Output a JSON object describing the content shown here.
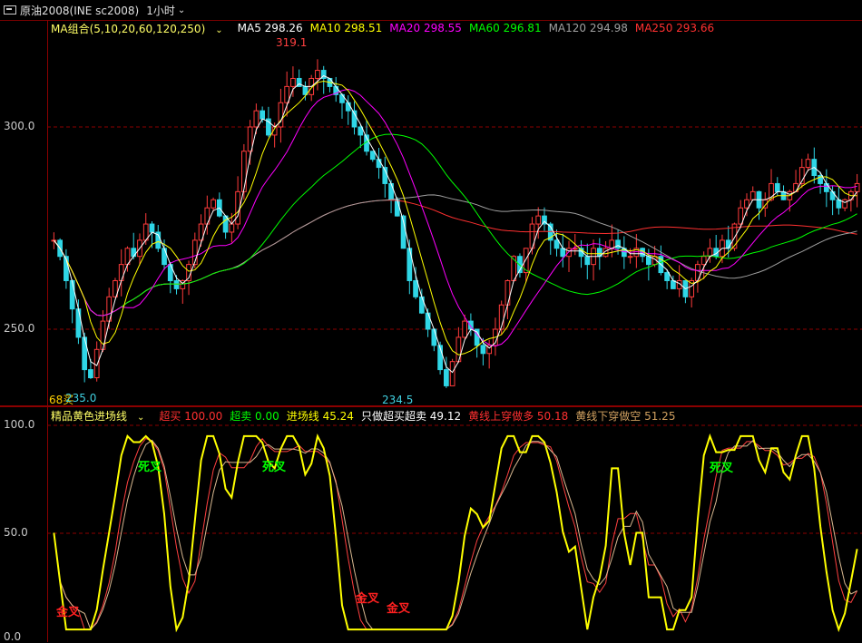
{
  "topbar": {
    "symbol": "原油2008(INE sc2008)",
    "period": "1小时"
  },
  "main_legend": {
    "group": "MA组合(5,10,20,60,120,250)",
    "ma5": "MA5 298.26",
    "ma10": "MA10 298.51",
    "ma20": "MA20 298.55",
    "ma60": "MA60 296.81",
    "ma120": "MA120 294.98",
    "ma250": "MA250 293.66",
    "colors": {
      "ma5": "#ffffff",
      "ma10": "#ffff00",
      "ma20": "#ff00ff",
      "ma60": "#00ff00",
      "ma120": "#a0a0a0",
      "ma250": "#ff3030"
    }
  },
  "main_axis": {
    "labels": [
      "300.0",
      "250.0"
    ],
    "values": [
      300,
      250
    ]
  },
  "price_marks": {
    "high": "319.1",
    "low": "234.5",
    "left_low": "235.0",
    "left_tag": "68买"
  },
  "sub_legend": {
    "name": "精品黄色进场线",
    "overbought": "超买 100.00",
    "oversold": "超卖 0.00",
    "entry": "进场线 45.24",
    "only_ob_os": "只做超买超卖 49.12",
    "cross_up": "黄线上穿做多 50.18",
    "cross_down": "黄线下穿做空 51.25"
  },
  "sub_axis": {
    "labels": [
      "100.0",
      "50.0",
      "0.0"
    ]
  },
  "signals": {
    "dead_cross": "死叉",
    "golden_cross": "金叉"
  },
  "chart_data": {
    "type": "candlestick",
    "instrument": "原油2008(INE sc2008)",
    "period": "1小时",
    "y_range": [
      225,
      325
    ],
    "price_high": 319.1,
    "price_low": 234.5,
    "close_series": [
      272,
      268,
      262,
      255,
      248,
      240,
      238,
      245,
      252,
      258,
      262,
      266,
      270,
      268,
      272,
      276,
      274,
      270,
      266,
      262,
      260,
      262,
      266,
      272,
      276,
      280,
      282,
      278,
      274,
      276,
      284,
      294,
      300,
      304,
      302,
      298,
      300,
      306,
      310,
      312,
      310,
      308,
      312,
      314,
      312,
      310,
      308,
      306,
      304,
      300,
      298,
      294,
      292,
      290,
      286,
      282,
      278,
      270,
      262,
      258,
      254,
      250,
      246,
      240,
      236,
      242,
      248,
      252,
      250,
      246,
      244,
      246,
      250,
      256,
      262,
      268,
      264,
      270,
      276,
      278,
      276,
      272,
      270,
      268,
      270,
      270,
      268,
      266,
      270,
      268,
      270,
      272,
      270,
      268,
      268,
      270,
      268,
      266,
      268,
      264,
      262,
      260,
      262,
      258,
      262,
      266,
      268,
      270,
      268,
      272,
      270,
      276,
      280,
      282,
      284,
      280,
      282,
      286,
      284,
      282,
      284,
      286,
      290,
      292,
      288,
      286,
      284,
      282,
      280,
      282,
      284,
      286
    ]
  }
}
